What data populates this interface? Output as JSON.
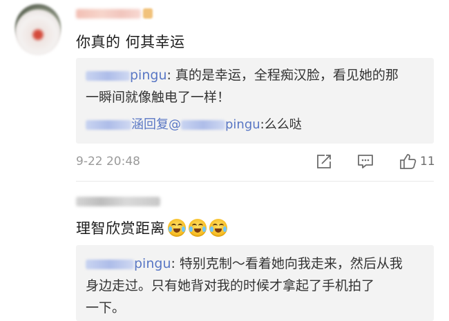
{
  "comments": [
    {
      "text": "你真的 何其幸运",
      "replies": [
        {
          "username_suffix": "pingu",
          "content_line1": ": 真的是幸运，全程痴汉脸，看见她的那",
          "content_line2": "一瞬间就像触电了一样！"
        },
        {
          "prefix_visible": "涵回复@",
          "target_suffix": "pingu",
          "content": ":么么哒"
        }
      ],
      "timestamp": "9-22 20:48",
      "like_count": "11"
    },
    {
      "text": "理智欣赏距离",
      "emoji": "laughing-crying",
      "replies": [
        {
          "username_suffix": "pingu",
          "content_line1": ": 特别克制～看着她向我走来，然后从我",
          "content_line2": "身边走过。只有她背对我的时候才拿起了手机拍了",
          "content_line3": "一下。"
        }
      ]
    }
  ],
  "icons": {
    "share": "share-icon",
    "comment": "comment-icon",
    "like": "like-icon"
  },
  "colors": {
    "username_link": "#5876c4",
    "reply_background": "#f3f3f3",
    "meta_text": "#9a9a9a"
  }
}
